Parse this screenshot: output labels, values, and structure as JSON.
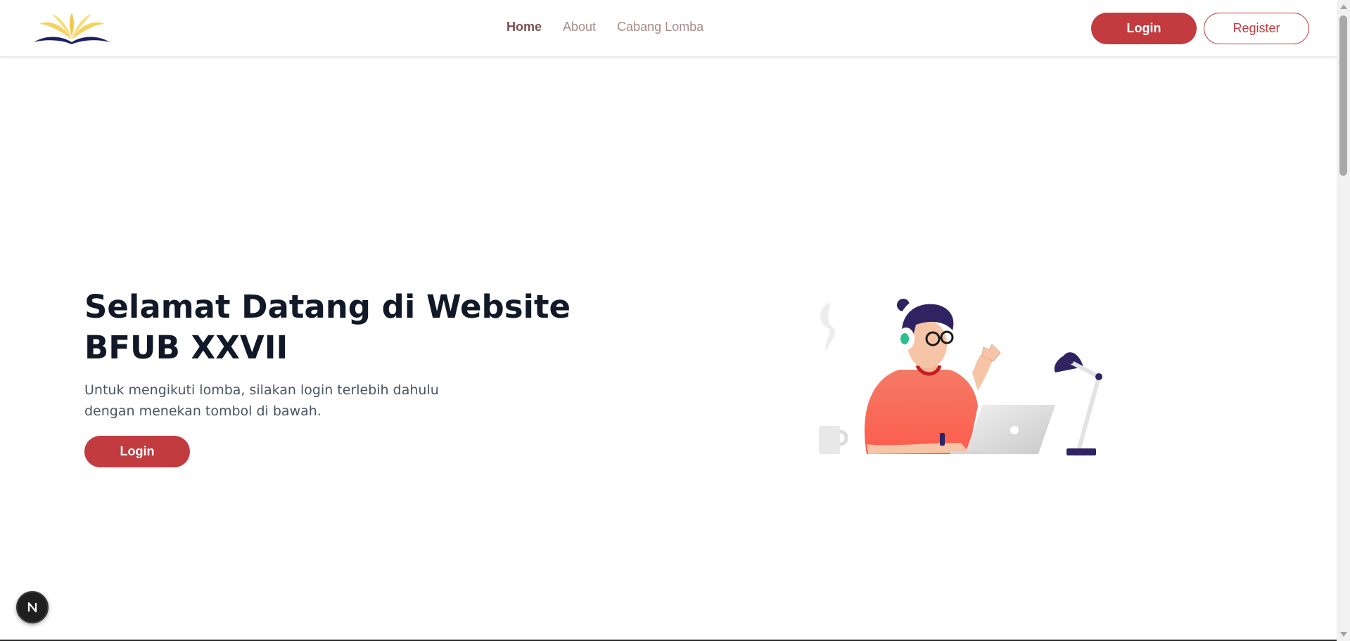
{
  "nav": {
    "home": "Home",
    "about": "About",
    "cabang_lomba": "Cabang Lomba"
  },
  "header": {
    "login_label": "Login",
    "register_label": "Register"
  },
  "hero": {
    "title": "Selamat Datang di Website BFUB XXVII",
    "subtitle": "Untuk mengikuti lomba, silakan login terlebih dahulu dengan menekan tombol di bawah.",
    "login_label": "Login"
  },
  "icons": {
    "logo": "book-flower-logo",
    "illustration": "person-with-laptop-illustration",
    "badge": "nextjs-icon"
  },
  "colors": {
    "brand": "#c23c3f",
    "logo_yellow": "#f4d35e",
    "logo_navy": "#1d2166",
    "shirt": "#fa6a5a",
    "hair": "#2f2362"
  }
}
